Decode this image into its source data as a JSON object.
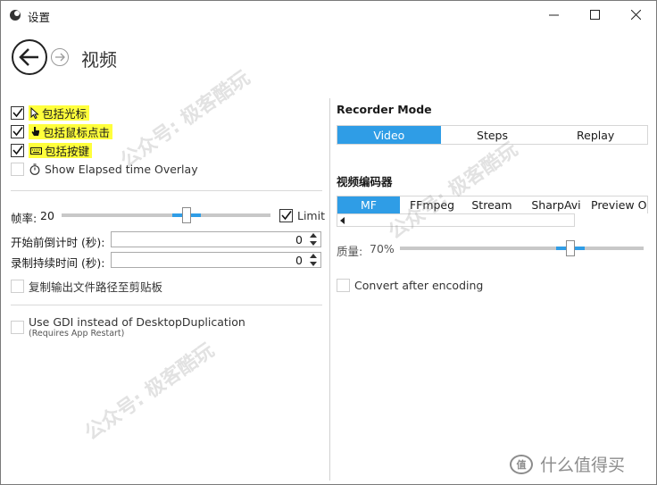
{
  "window": {
    "title": "设置"
  },
  "header": {
    "page_title": "视频"
  },
  "left": {
    "checkboxes": [
      {
        "label": "包括光标",
        "checked": true,
        "highlighted": true,
        "icon": "cursor-arrow-icon"
      },
      {
        "label": "包括鼠标点击",
        "checked": true,
        "highlighted": true,
        "icon": "hand-pointer-icon"
      },
      {
        "label": "包括按键",
        "checked": true,
        "highlighted": true,
        "icon": "keyboard-icon"
      },
      {
        "label": "Show Elapsed time Overlay",
        "checked": false,
        "highlighted": false,
        "icon": "stopwatch-icon"
      }
    ],
    "framerate": {
      "label": "帧率:",
      "value": "20",
      "slider_fraction": 0.6,
      "limit_label": "Limit",
      "limit_checked": true
    },
    "countdown": {
      "label": "开始前倒计时 (秒):",
      "value": "0"
    },
    "duration": {
      "label": "录制持续时间 (秒):",
      "value": "0"
    },
    "copy_path": {
      "label": "复制输出文件路径至剪贴板",
      "checked": false
    },
    "gdi": {
      "label": "Use GDI instead of DesktopDuplication",
      "sub": "(Requires App Restart)",
      "checked": false
    }
  },
  "right": {
    "recorder_mode": {
      "title": "Recorder Mode",
      "options": [
        "Video",
        "Steps",
        "Replay"
      ],
      "selected": "Video"
    },
    "encoder": {
      "title": "视频编码器",
      "tabs": [
        "MF",
        "FFmpeg",
        "Stream",
        "SharpAvi",
        "Preview Or"
      ],
      "selected": "MF"
    },
    "quality": {
      "label": "质量:",
      "value": "70%",
      "slider_fraction": 0.7
    },
    "convert": {
      "label": "Convert after encoding",
      "checked": false
    }
  },
  "watermarks": [
    "公众号: 极客酷玩",
    "公众号: 极客酷玩",
    "公众号: 极客酷玩"
  ],
  "brand": {
    "text": "什么值得买",
    "badge": "值"
  },
  "colors": {
    "accent": "#2f9de6",
    "highlight": "#ffff3c"
  }
}
